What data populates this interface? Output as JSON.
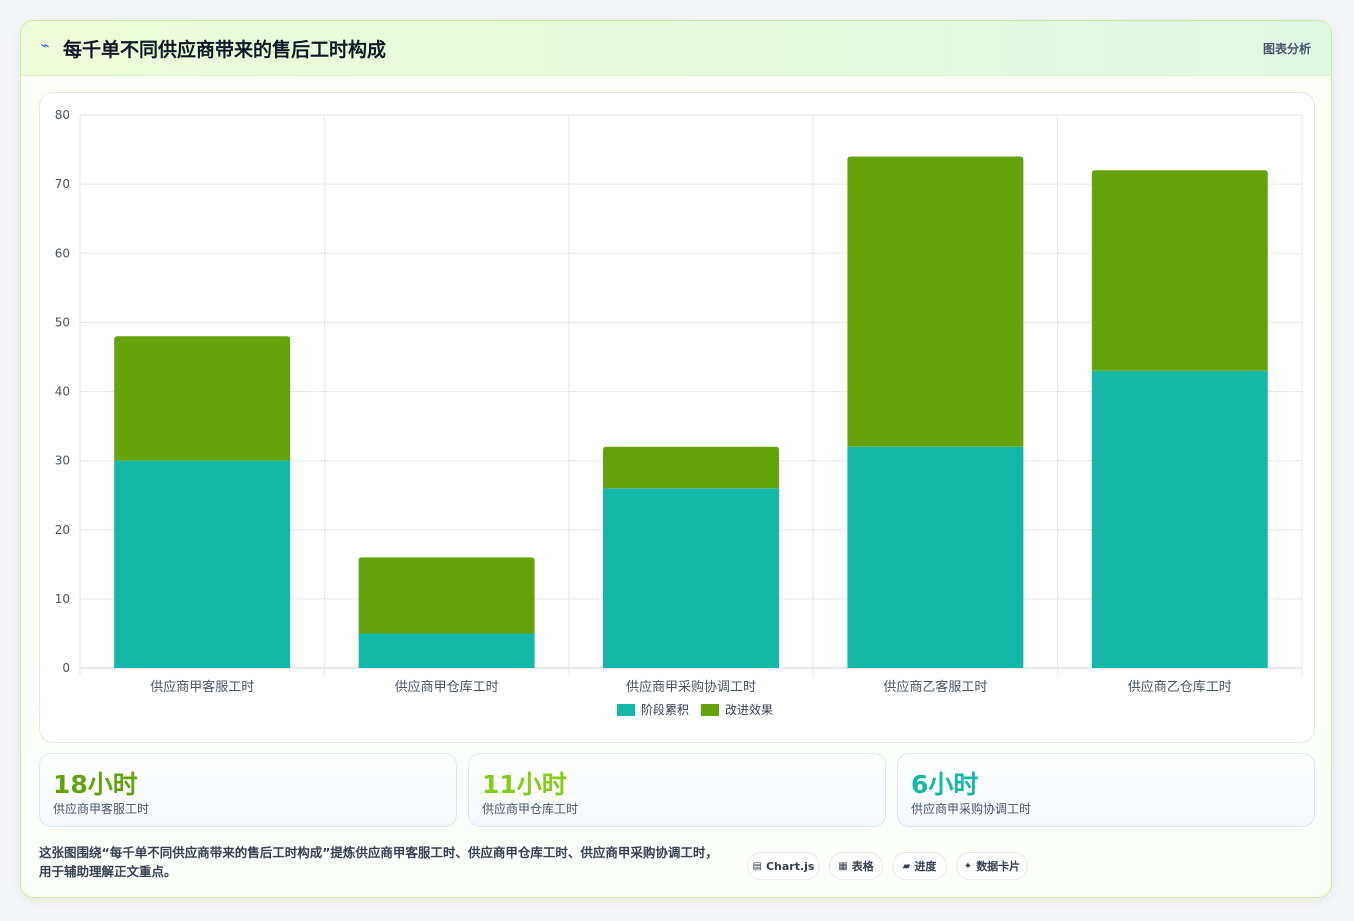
{
  "header": {
    "icon": "chart-icon",
    "title": "每千单不同供应商带来的售后工时构成",
    "tag": "图表分析"
  },
  "chart_data": {
    "type": "bar",
    "stacked": true,
    "categories": [
      "供应商甲客服工时",
      "供应商甲仓库工时",
      "供应商甲采购协调工时",
      "供应商乙客服工时",
      "供应商乙仓库工时"
    ],
    "series": [
      {
        "name": "阶段累积",
        "color": "#14b8a6",
        "values": [
          30,
          5,
          26,
          32,
          43
        ]
      },
      {
        "name": "改进效果",
        "color": "#65a30d",
        "values": [
          18,
          11,
          6,
          42,
          29
        ]
      }
    ],
    "ylim": [
      0,
      80
    ],
    "yticks": [
      0,
      10,
      20,
      30,
      40,
      50,
      60,
      70,
      80
    ],
    "grid": true,
    "legend": "bottom"
  },
  "stats": [
    {
      "value": "18小时",
      "label": "供应商甲客服工时",
      "color": "#65a30d"
    },
    {
      "value": "11小时",
      "label": "供应商甲仓库工时",
      "color": "#84cc16"
    },
    {
      "value": "6小时",
      "label": "供应商甲采购协调工时",
      "color": "#14b8a6"
    }
  ],
  "description": "这张图围绕“每千单不同供应商带来的售后工时构成”提炼供应商甲客服工时、供应商甲仓库工时、供应商甲采购协调工时，用于辅助理解正文重点。",
  "badges": [
    {
      "icon": "chart-icon",
      "glyph": "▤",
      "label": "Chart.js"
    },
    {
      "icon": "table-icon",
      "glyph": "▦",
      "label": "表格"
    },
    {
      "icon": "progress-icon",
      "glyph": "▰",
      "label": "进度"
    },
    {
      "icon": "card-icon",
      "glyph": "✦",
      "label": "数据卡片"
    }
  ]
}
